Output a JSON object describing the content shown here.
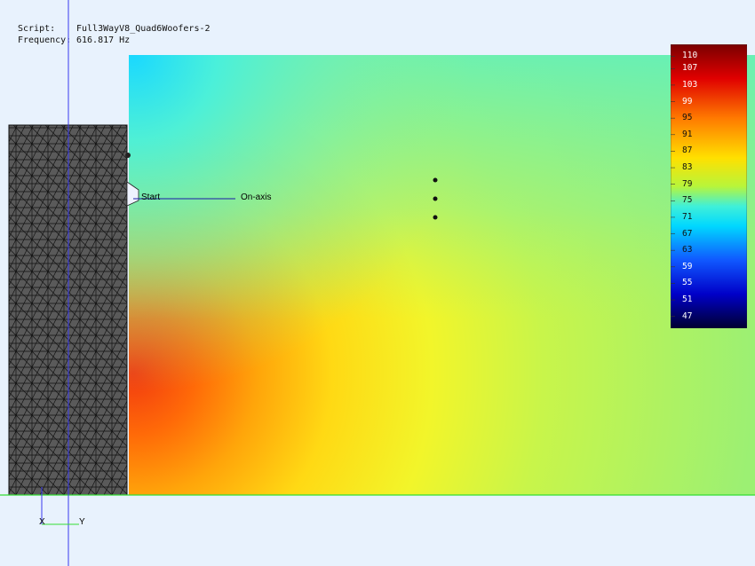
{
  "info": {
    "script_label": "Script:",
    "script_value": "Full3WayV8_Quad6Woofers-2",
    "frequency_label": "Frequency:",
    "frequency_value": "616.817 Hz"
  },
  "annotations": {
    "start": "Start",
    "on_axis": "On-axis"
  },
  "axes": {
    "x_label": "X",
    "y_label": "Y"
  },
  "colorbar": {
    "labels": [
      "110",
      "107",
      "103",
      "99",
      "95",
      "91",
      "87",
      "83",
      "79",
      "75",
      "71",
      "67",
      "63",
      "59",
      "55",
      "51",
      "47"
    ],
    "min": 45,
    "max": 112
  },
  "colors": {
    "axis_blue": "#3a3af0",
    "ground_green": "#33dd33",
    "mesh_fill": "#5a5a5a",
    "mesh_line": "#111111"
  }
}
